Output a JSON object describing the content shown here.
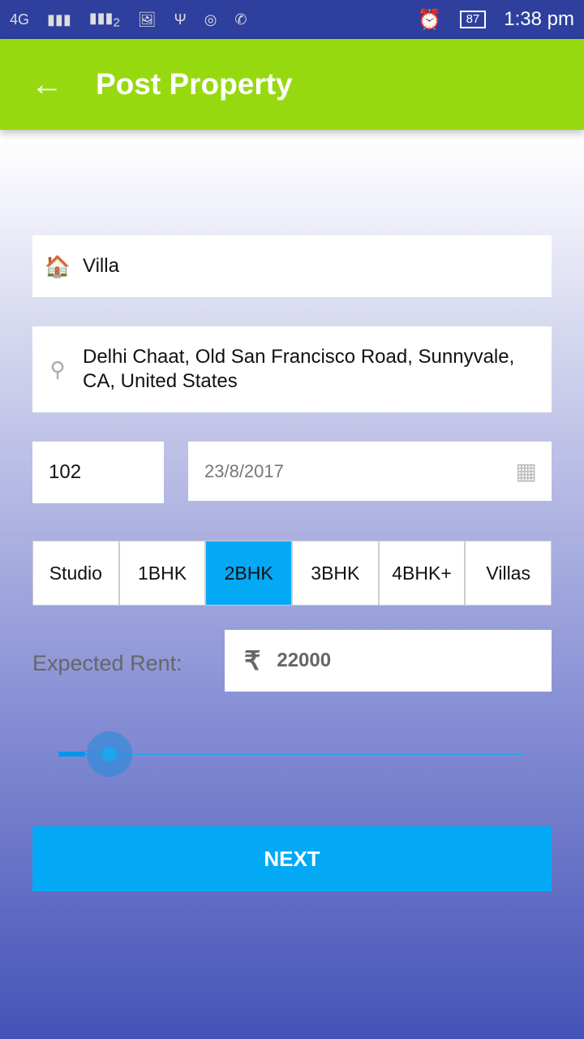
{
  "status_bar": {
    "network": "4G",
    "sim2": "2",
    "battery": "87",
    "time": "1:38 pm"
  },
  "app_bar": {
    "title": "Post Property",
    "back_icon": "arrow-left-icon"
  },
  "form": {
    "property_type": "Villa",
    "address": "Delhi Chaat, Old San Francisco Road, Sunnyvale, CA, United States",
    "unit_number": "102",
    "date": "23/8/2017",
    "bhk_options": [
      "Studio",
      "1BHK",
      "2BHK",
      "3BHK",
      "4BHK+",
      "Villas"
    ],
    "selected_bhk": "2BHK",
    "rent_label": "Expected Rent:",
    "currency_symbol": "₹",
    "rent_value": "22000",
    "rent_slider_fraction": 0.11,
    "next_label": "NEXT"
  },
  "colors": {
    "accent": "#03a9f4",
    "appbar": "#97d90f",
    "statusbar": "#2f3f9e"
  }
}
